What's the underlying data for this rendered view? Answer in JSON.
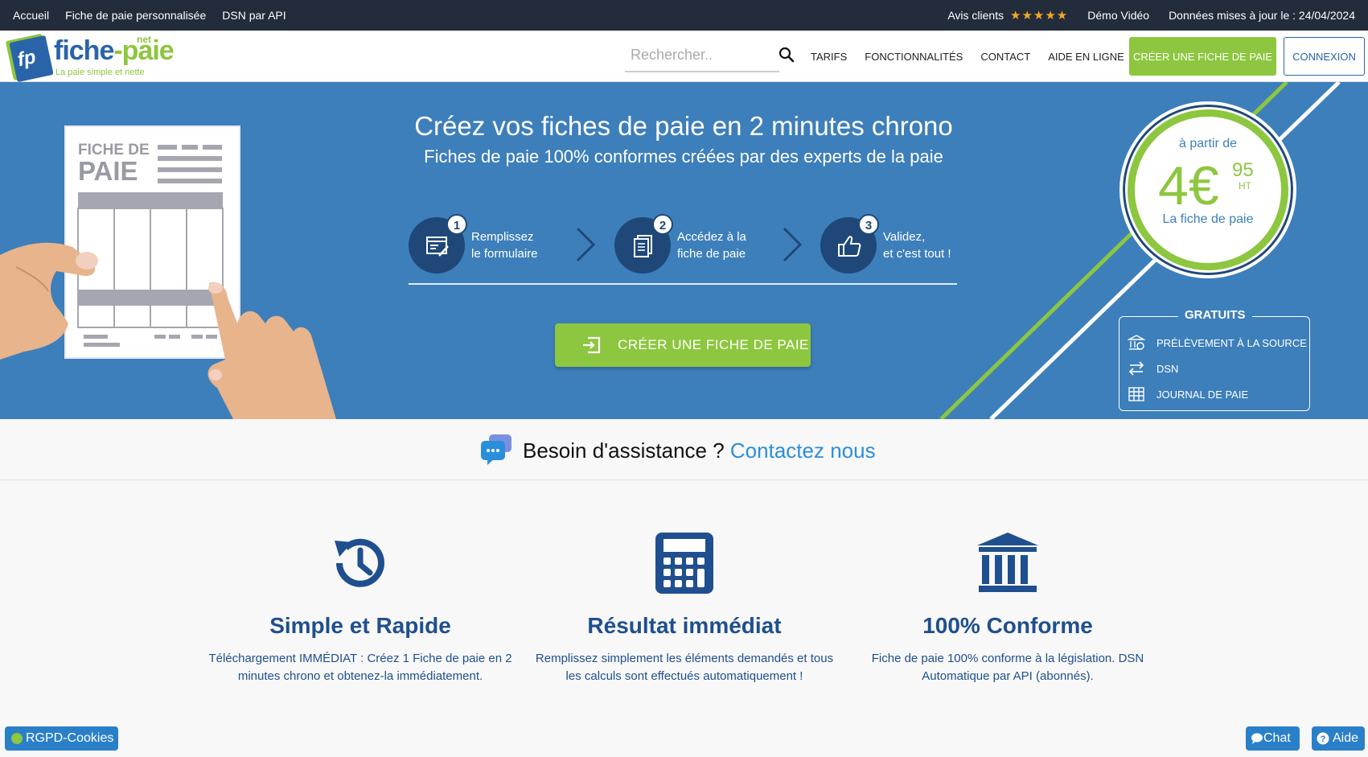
{
  "topbar": {
    "links": [
      "Accueil",
      "Fiche de paie personnalisée",
      "DSN par API"
    ],
    "reviews_label": "Avis clients",
    "stars": "★★★★★",
    "demo": "Démo Vidéo",
    "update": "Données mises à jour le : 24/04/2024"
  },
  "logo": {
    "word_a": "fiche",
    "word_b": "-paie",
    "suffix": "net",
    "tagline": "La paie simple et nette",
    "badge": "fp"
  },
  "search": {
    "placeholder": "Rechercher.."
  },
  "nav": {
    "items": [
      "TARIFS",
      "FONCTIONNALITÉS",
      "CONTACT",
      "AIDE EN LIGNE"
    ],
    "create": "CRÉER UNE FICHE DE PAIE",
    "login": "CONNEXION"
  },
  "hero": {
    "title": "Créez vos fiches de paie en 2 minutes chrono",
    "subtitle": "Fiches de paie 100% conformes créées par des experts de la paie",
    "steps": [
      {
        "num": "1",
        "line1": "Remplissez",
        "line2": "le formulaire",
        "icon": "form-icon"
      },
      {
        "num": "2",
        "line1": "Accédez à la",
        "line2": "fiche de paie",
        "icon": "document-icon"
      },
      {
        "num": "3",
        "line1": "Validez,",
        "line2": "et c'est tout !",
        "icon": "thumbs-up-icon"
      }
    ],
    "cta": "CRÉER UNE FICHE DE PAIE",
    "doc_title_1": "FICHE DE",
    "doc_title_2": "PAIE"
  },
  "price": {
    "from": "à partir de",
    "amount": "4€",
    "cents": "95",
    "ht": "HT",
    "unit": "La fiche de paie"
  },
  "free": {
    "title": "GRATUITS",
    "items": [
      {
        "label": "PRÉLÈVEMENT À LA SOURCE",
        "icon": "bank-icon"
      },
      {
        "label": "DSN",
        "icon": "exchange-icon"
      },
      {
        "label": "JOURNAL DE PAIE",
        "icon": "table-icon"
      }
    ]
  },
  "assist": {
    "text": "Besoin d'assistance ?",
    "link": "Contactez nous"
  },
  "features": [
    {
      "title": "Simple et Rapide",
      "text": "Téléchargement IMMÉDIAT : Créez 1 Fiche de paie en 2 minutes chrono et obtenez-la immédiatement.",
      "icon": "history-icon"
    },
    {
      "title": "Résultat immédiat",
      "text": "Remplissez simplement les éléments demandés et tous les calculs sont effectués automatiquement !",
      "icon": "calculator-icon"
    },
    {
      "title": "100% Conforme",
      "text": "Fiche de paie 100% conforme à la législation. DSN Automatique par API (abonnés).",
      "icon": "institution-icon"
    }
  ],
  "bottom": {
    "rgpd": "RGPD-Cookies",
    "chat": "Chat",
    "help": "Aide"
  },
  "colors": {
    "brand_blue": "#3d7fba",
    "dark_blue": "#1f4878",
    "green": "#8dc63f",
    "topbar": "#232c3b",
    "text_blue": "#1f4f8e",
    "link_blue": "#2a8fdb"
  }
}
